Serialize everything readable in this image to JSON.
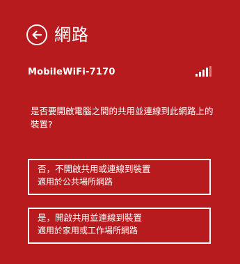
{
  "header": {
    "title": "網路",
    "back_icon": "back-arrow-icon"
  },
  "network": {
    "name": "MobileWiFi-7170",
    "signal_icon": "signal-strength-icon",
    "signal_bars": 4
  },
  "prompt": {
    "question": "是否要開啟電腦之間的共用並連線到此網路上的裝置?"
  },
  "options": [
    {
      "title": "否，不開啟共用或連線到裝置",
      "subtitle": "適用於公共場所網路"
    },
    {
      "title": "是，開啟共用並連線到裝置",
      "subtitle": "適用於家用或工作場所網路"
    }
  ],
  "colors": {
    "background": "#b71b1e",
    "foreground": "#ffffff"
  }
}
